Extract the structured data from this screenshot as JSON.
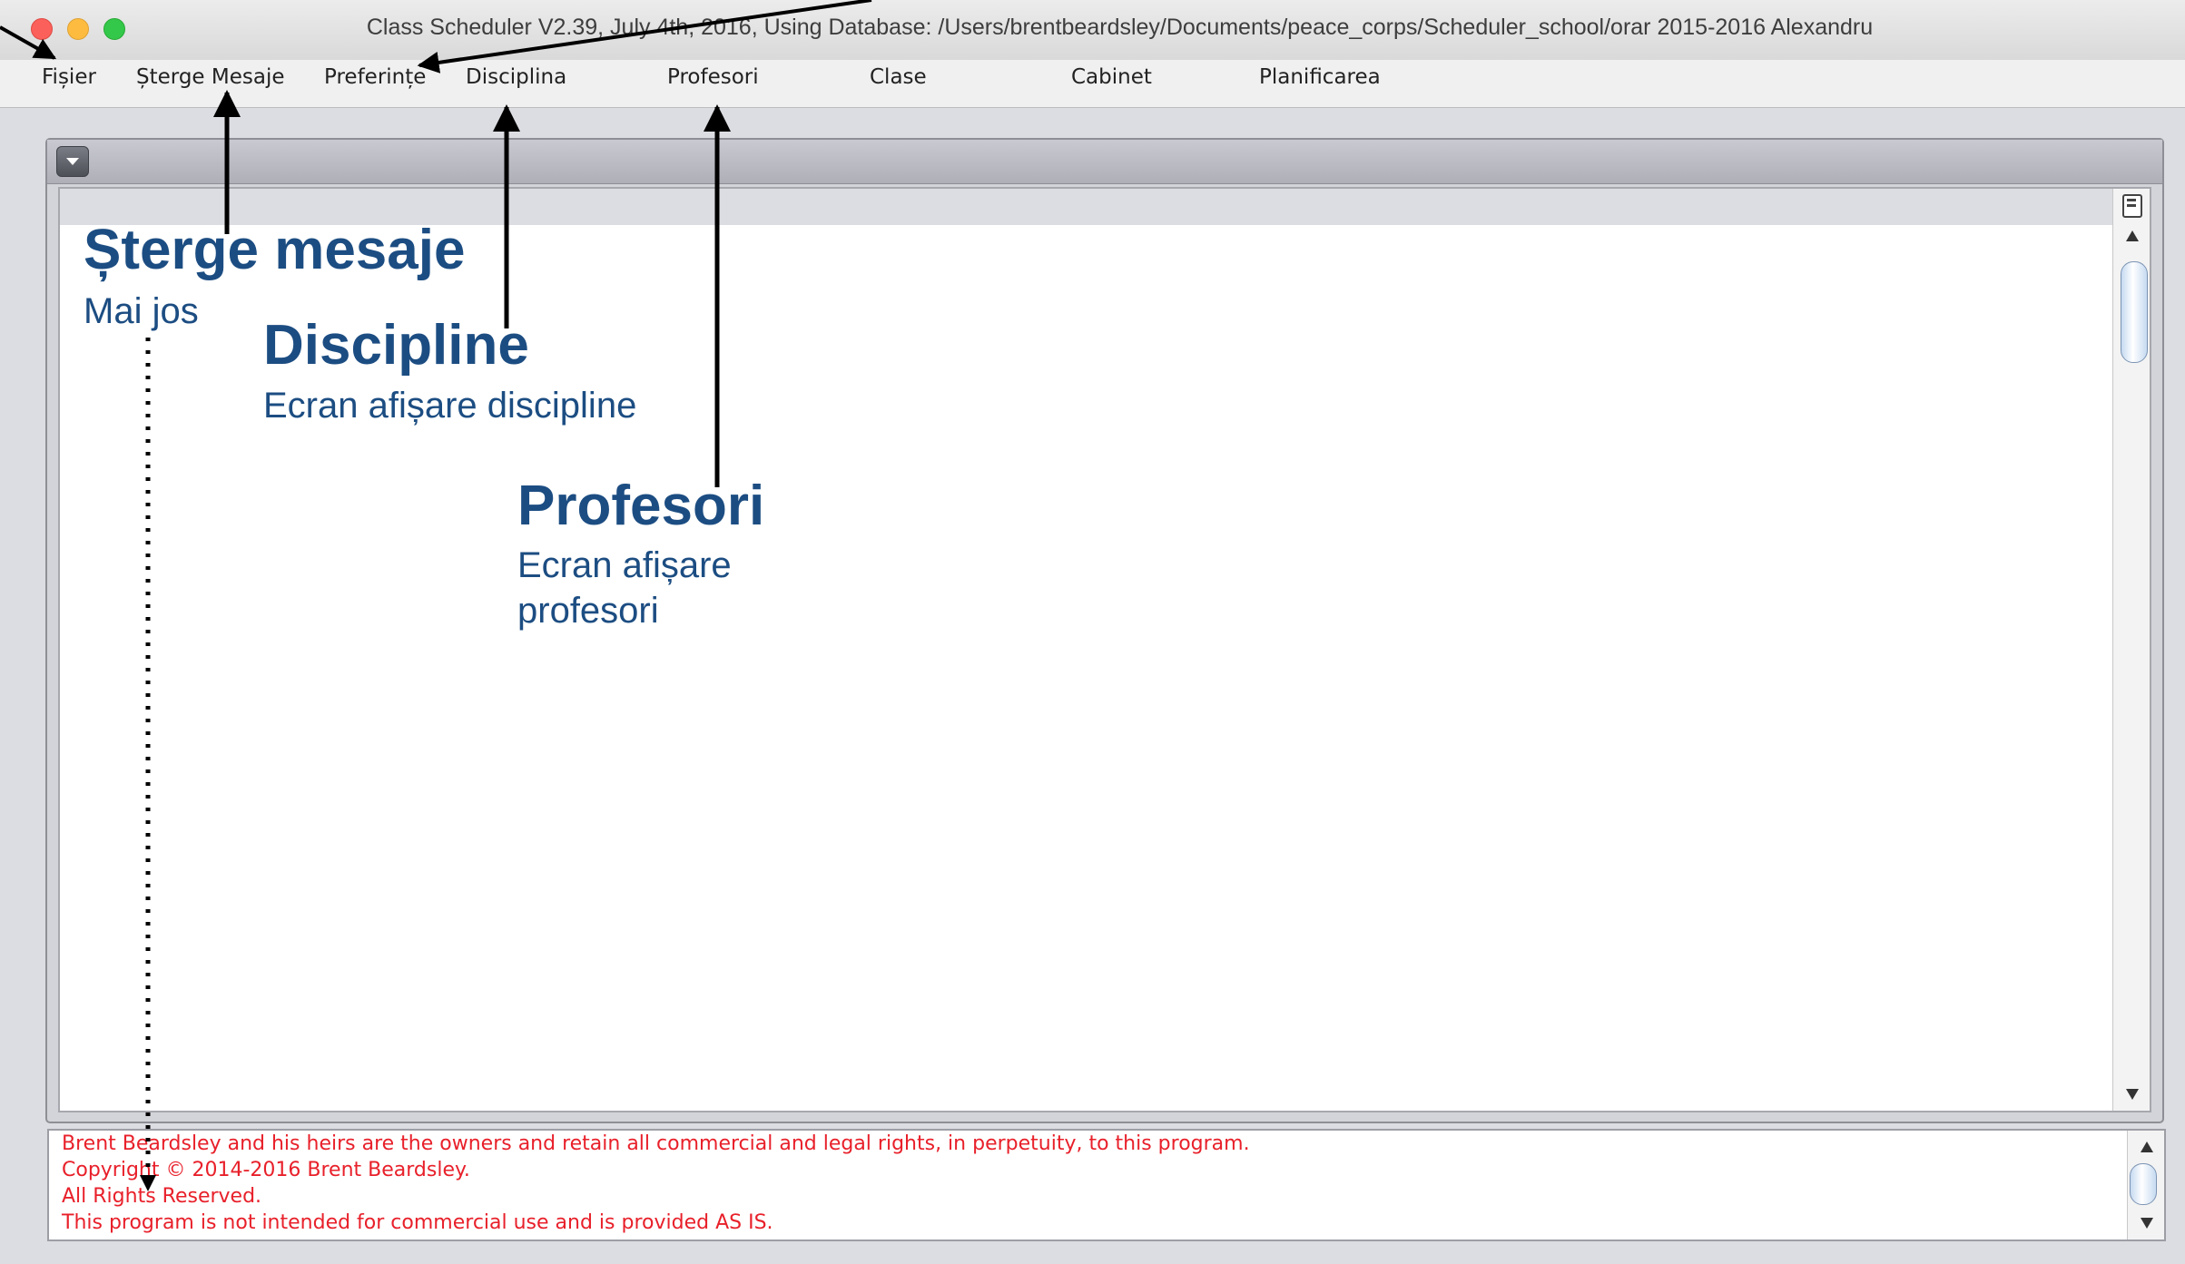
{
  "window": {
    "title": "Class Scheduler V2.39, July 4th, 2016, Using Database: /Users/brentbeardsley/Documents/peace_corps/Scheduler_school/orar 2015-2016 Alexandru"
  },
  "menu": {
    "items": [
      "Fișier",
      "Șterge Mesaje",
      "Preferințe",
      "Disciplina",
      "Profesori",
      "Clase",
      "Cabinet",
      "Planificarea"
    ]
  },
  "annotations": {
    "sterge": {
      "title": "Șterge mesaje",
      "subtitle": "Mai jos"
    },
    "discipline": {
      "title": "Discipline",
      "subtitle": "Ecran afișare discipline"
    },
    "profesori": {
      "title": "Profesori",
      "subtitle_line1": "Ecran afișare",
      "subtitle_line2": "profesori"
    }
  },
  "footer": {
    "lines": [
      "Brent Beardsley and his heirs are the owners and retain all commercial and legal rights, in perpetuity, to this program.",
      "Copyright © 2014-2016 Brent Beardsley.",
      "All Rights Reserved.",
      "This program is not intended for commercial use and is provided AS IS."
    ]
  },
  "colors": {
    "annotation": "#1c4d82",
    "footer_text": "#e8202a",
    "menubar_bg": "#f0f0f0",
    "window_bg": "#dcdde2"
  }
}
